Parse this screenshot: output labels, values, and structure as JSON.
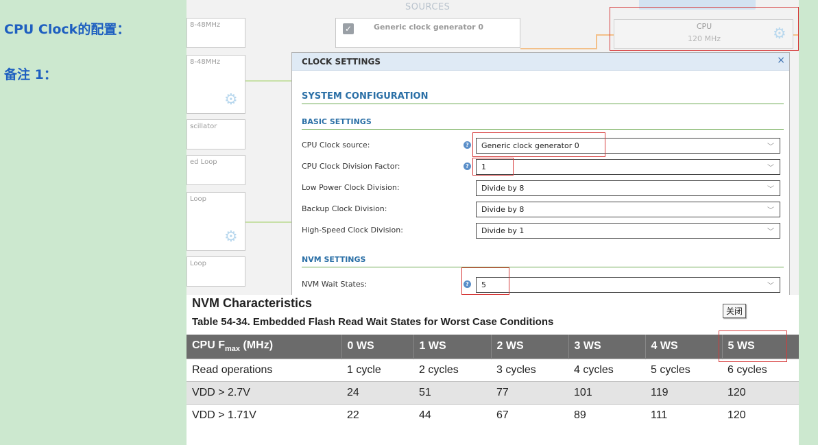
{
  "side": {
    "heading1": "CPU Clock的配置：",
    "heading2": "备注 1："
  },
  "background": {
    "sources_label": "SOURCES",
    "generic_clock_box": "Generic clock generator 0",
    "cpu_box_title": "CPU",
    "cpu_box_freq": "120 MHz",
    "left_boxes": [
      "8-48MHz",
      "8-48MHz",
      "scillator",
      "ed Loop",
      "Loop",
      "Loop"
    ]
  },
  "dialog": {
    "title": "CLOCK SETTINGS",
    "close": "×",
    "section_system": "SYSTEM CONFIGURATION",
    "section_basic": "BASIC SETTINGS",
    "section_nvm": "NVM SETTINGS",
    "fields": [
      {
        "label": "CPU Clock source:",
        "value": "Generic clock generator 0"
      },
      {
        "label": "CPU Clock Division Factor:",
        "value": "1"
      },
      {
        "label": "Low Power Clock Division:",
        "value": "Divide by 8"
      },
      {
        "label": "Backup Clock Division:",
        "value": "Divide by 8"
      },
      {
        "label": "High-Speed Clock Division:",
        "value": "Divide by 1"
      }
    ],
    "nvm_field": {
      "label": "NVM Wait States:",
      "value": "5"
    }
  },
  "datasheet": {
    "title": "NVM Characteristics",
    "caption": "Table 54-34. Embedded Flash Read Wait States for Worst Case Conditions",
    "close_tooltip": "关闭",
    "header_cpu": "CPU F",
    "header_cpu_sub": "max",
    "header_cpu_unit": " (MHz)",
    "headers": [
      "0 WS",
      "1 WS",
      "2 WS",
      "3 WS",
      "4 WS",
      "5 WS"
    ],
    "rows": [
      {
        "label": "Read operations",
        "cells": [
          "1 cycle",
          "2 cycles",
          "3 cycles",
          "4 cycles",
          "5 cycles",
          "6 cycles"
        ]
      },
      {
        "label": "VDD > 2.7V",
        "cells": [
          "24",
          "51",
          "77",
          "101",
          "119",
          "120"
        ]
      },
      {
        "label": "VDD > 1.71V",
        "cells": [
          "22",
          "44",
          "67",
          "89",
          "111",
          "120"
        ]
      }
    ]
  },
  "colors": {
    "page_bg": "#cce8cf",
    "heading": "#1e5fc0",
    "highlight_red": "#d63a3a",
    "section_blue": "#2a6fa6",
    "table_header": "#6b6b6b"
  }
}
